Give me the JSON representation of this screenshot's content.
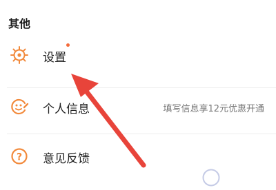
{
  "section": {
    "title": "其他"
  },
  "menu": {
    "settings": {
      "label": "设置",
      "icon": "settings-gear-icon",
      "has_badge": true
    },
    "profile": {
      "label": "个人信息",
      "hint": "填写信息享12元优惠开通",
      "icon": "profile-edit-icon"
    },
    "feedback": {
      "label": "意见反馈",
      "icon": "question-icon"
    }
  },
  "colors": {
    "accent": "#f28a3c",
    "badge": "#f46a3a",
    "arrow": "#e8443a"
  }
}
